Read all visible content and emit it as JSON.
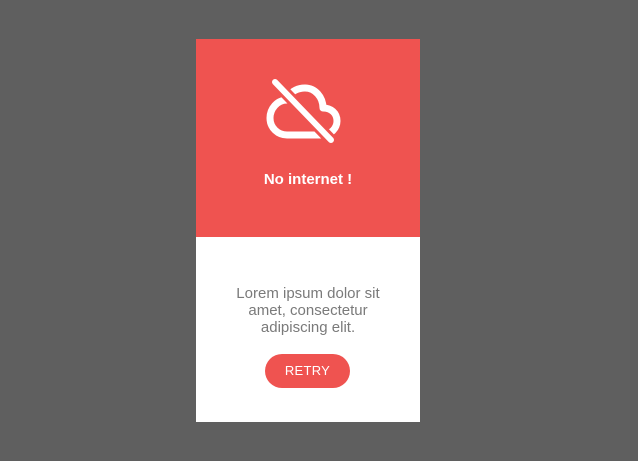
{
  "card": {
    "icon": "cloud-off-icon",
    "title": "No internet !",
    "message": "Lorem ipsum dolor sit amet, consectetur adipiscing elit.",
    "retry_label": "RETRY"
  },
  "colors": {
    "background": "#5f5f5f",
    "accent": "#ef5350",
    "card": "#ffffff",
    "message_text": "#7a7a7a"
  }
}
